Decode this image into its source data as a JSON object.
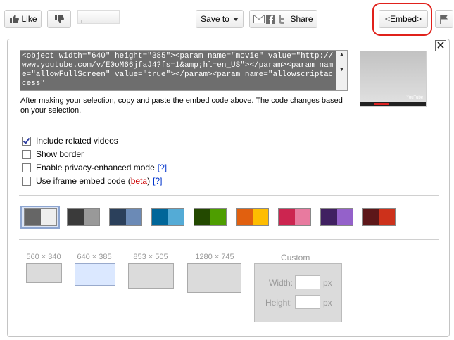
{
  "toolbar": {
    "like_label": "Like",
    "save_to_label": "Save to",
    "share_label": "Share",
    "embed_label": "<Embed>"
  },
  "embed": {
    "code": "<object width=\"640\" height=\"385\"><param name=\"movie\" value=\"http://www.youtube.com/v/E0oM66jfaJ4?fs=1&amp;hl=en_US\"></param><param name=\"allowFullScreen\" value=\"true\"></param><param name=\"allowscriptaccess\"",
    "description": "After making your selection, copy and paste the embed code above. The code changes based on your selection.",
    "preview_logo": "YouTube"
  },
  "options": [
    {
      "label": "Include related videos",
      "checked": true
    },
    {
      "label": "Show border",
      "checked": false
    },
    {
      "label": "Enable privacy-enhanced mode",
      "link": "[?]",
      "checked": false
    },
    {
      "label": "Use iframe embed code (",
      "beta": "beta",
      "label_end": ")",
      "link": "[?]",
      "checked": false
    }
  ],
  "color_themes": [
    {
      "a": "#666666",
      "b": "#eeeeee",
      "selected": true
    },
    {
      "a": "#3a3a3a",
      "b": "#999999"
    },
    {
      "a": "#2b405b",
      "b": "#6b8ab6"
    },
    {
      "a": "#006699",
      "b": "#54abd6"
    },
    {
      "a": "#234900",
      "b": "#4e9e00"
    },
    {
      "a": "#e1600f",
      "b": "#febd01"
    },
    {
      "a": "#cc2550",
      "b": "#e87a9f"
    },
    {
      "a": "#402061",
      "b": "#9461ca"
    },
    {
      "a": "#5d1719",
      "b": "#cd311b"
    }
  ],
  "sizes": [
    {
      "label": "560 × 340"
    },
    {
      "label": "640 × 385",
      "selected": true
    },
    {
      "label": "853 × 505"
    },
    {
      "label": "1280 × 745"
    }
  ],
  "custom": {
    "title": "Custom",
    "width_label": "Width:",
    "height_label": "Height:",
    "unit": "px"
  },
  "colors": {
    "highlight": "#e0211b",
    "selected_size": "#dbe8ff",
    "beta": "#cc0000",
    "link": "#0033cc"
  }
}
